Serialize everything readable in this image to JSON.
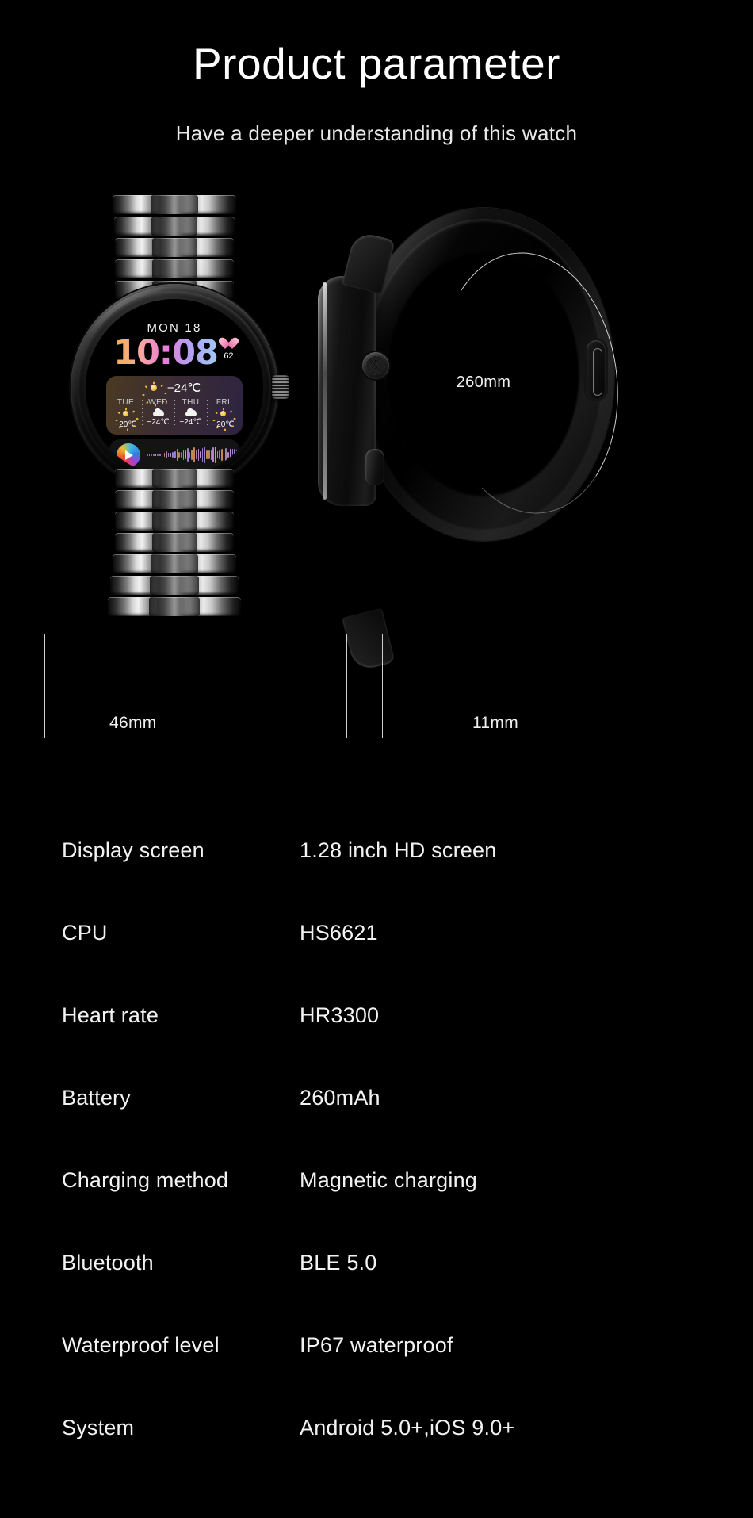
{
  "header": {
    "title": "Product parameter",
    "subtitle": "Have a deeper understanding of this watch"
  },
  "watch_face": {
    "date": "MON 18",
    "time": "10:08",
    "heart_icon": "heart-icon",
    "heart_rate": "62",
    "current_weather_icon": "sun-icon",
    "current_temp": "−24℃",
    "forecast": [
      {
        "day": "TUE",
        "icon": "sun-icon",
        "temp": "−20℃"
      },
      {
        "day": "WED",
        "icon": "cloud-icon",
        "temp": "−24℃"
      },
      {
        "day": "THU",
        "icon": "cloud-icon",
        "temp": "−24℃"
      },
      {
        "day": "FRI",
        "icon": "sun-icon",
        "temp": "−20℃"
      }
    ],
    "media": {
      "play_icon": "play-icon",
      "waveform_icon": "audio-waveform-icon"
    }
  },
  "dimensions": {
    "width": "46mm",
    "thickness": "11mm",
    "strap_length": "260mm"
  },
  "specs": [
    {
      "key": "Display screen",
      "value": "1.28 inch HD screen"
    },
    {
      "key": "CPU",
      "value": "HS6621"
    },
    {
      "key": "Heart rate",
      "value": "HR3300"
    },
    {
      "key": "Battery",
      "value": "260mAh"
    },
    {
      "key": "Charging method",
      "value": "Magnetic charging"
    },
    {
      "key": "Bluetooth",
      "value": "BLE 5.0"
    },
    {
      "key": "Waterproof level",
      "value": "IP67 waterproof"
    },
    {
      "key": "System",
      "value": "Android 5.0+,iOS 9.0+"
    }
  ],
  "colors": {
    "background": "#000000",
    "text": "#f2f2f2",
    "dimension_line": "#cfcfcf"
  }
}
